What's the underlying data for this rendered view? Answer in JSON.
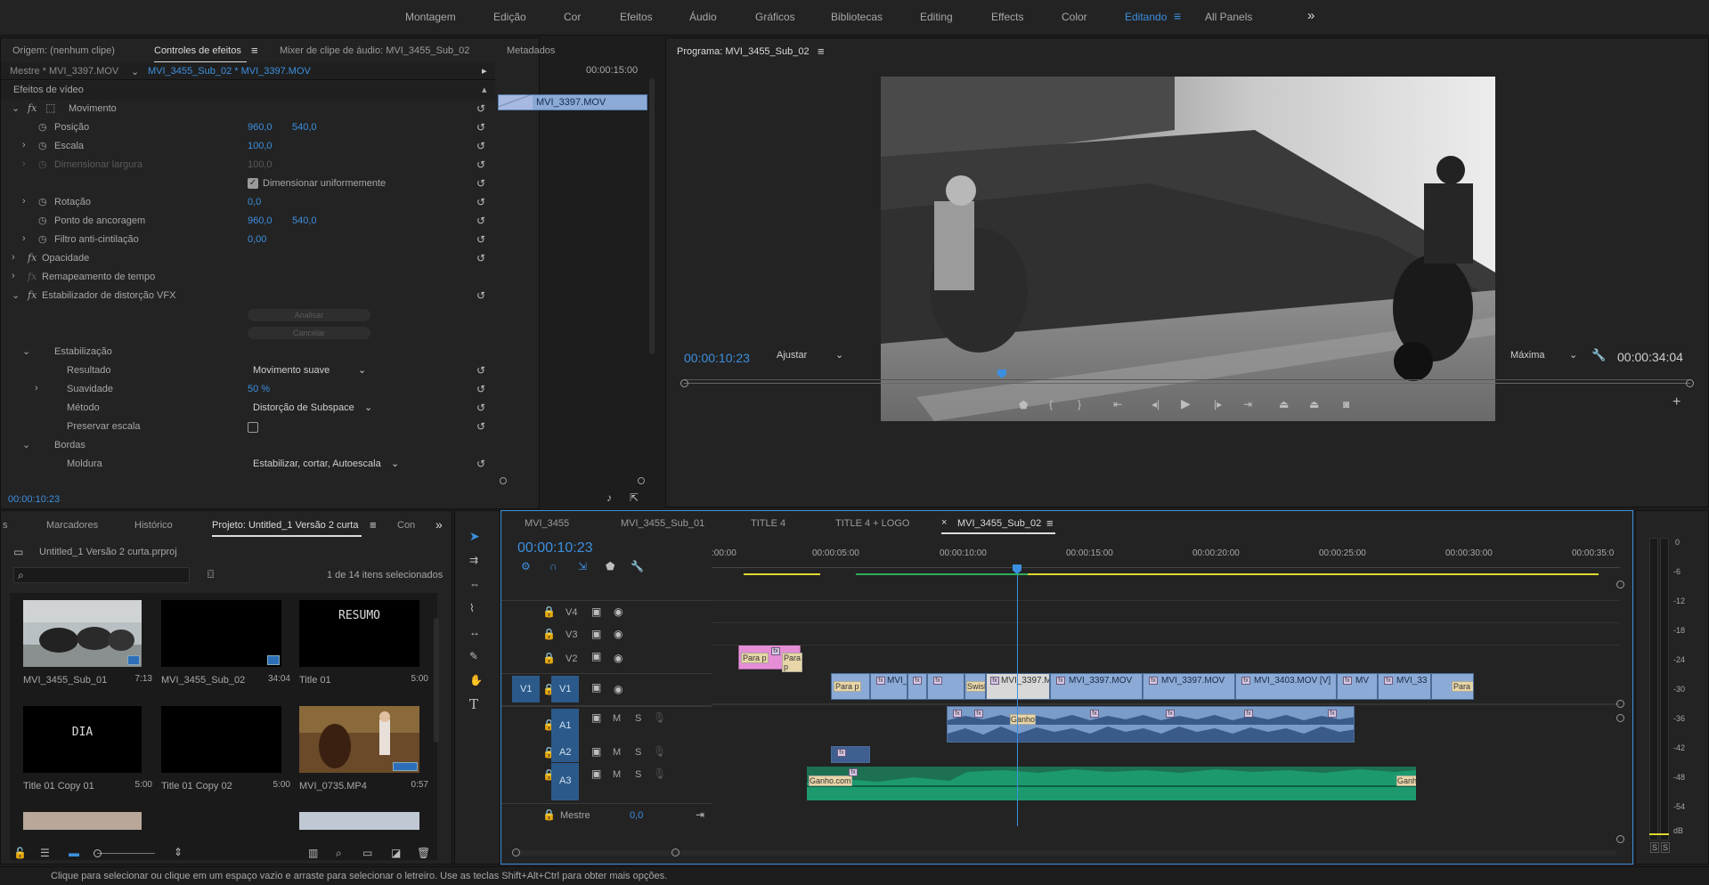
{
  "workspaces": [
    "Montagem",
    "Edição",
    "Cor",
    "Efeitos",
    "Áudio",
    "Gráficos",
    "Bibliotecas",
    "Editing",
    "Effects",
    "Color",
    "Editando",
    "All Panels"
  ],
  "workspace_active": "Editando",
  "effect_controls": {
    "tabs": [
      "Origem: (nenhum clipe)",
      "Controles de efeitos",
      "Mixer de clipe de áudio: MVI_3455_Sub_02",
      "Metadados"
    ],
    "active_tab": "Controles de efeitos",
    "master_label": "Mestre * MVI_3397.MOV",
    "sequence_label": "MVI_3455_Sub_02 * MVI_3397.MOV",
    "mini_timecode": "00:00:15:00",
    "mini_clip": "MVI_3397.MOV",
    "section_video": "Efeitos de vídeo",
    "motion": "Movimento",
    "position": "Posição",
    "position_x": "960,0",
    "position_y": "540,0",
    "scale": "Escala",
    "scale_val": "100,0",
    "scale_width": "Dimensionar largura",
    "scale_width_val": "100,0",
    "uniform_scale": "Dimensionar uniformemente",
    "rotation": "Rotação",
    "rotation_val": "0,0",
    "anchor": "Ponto de ancoragem",
    "anchor_x": "960,0",
    "anchor_y": "540,0",
    "flicker": "Filtro anti-cintilação",
    "flicker_val": "0,00",
    "opacity": "Opacidade",
    "time_remap": "Remapeamento de tempo",
    "vfx": "Estabilizador de distorção VFX",
    "analyze": "Analisar",
    "cancel": "Cancelar",
    "stabilization": "Estabilização",
    "result": "Resultado",
    "result_val": "Movimento suave",
    "smoothness": "Suavidade",
    "smoothness_val": "50 %",
    "method": "Método",
    "method_val": "Distorção de Subspace",
    "preserve_scale": "Preservar escala",
    "borders": "Bordas",
    "frame": "Moldura",
    "frame_val": "Estabilizar, cortar, Autoescala",
    "timecode": "00:00:10:23"
  },
  "program": {
    "title": "Programa: MVI_3455_Sub_02",
    "timecode": "00:00:10:23",
    "fit": "Ajustar",
    "quality": "Máxima",
    "duration": "00:00:34:04"
  },
  "project": {
    "tabs": [
      "s",
      "Marcadores",
      "Histórico",
      "Projeto: Untitled_1 Versão 2 curta",
      "Con"
    ],
    "active_tab": "Projeto: Untitled_1 Versão 2 curta",
    "file": "Untitled_1 Versão 2 curta.prproj",
    "search_placeholder": "",
    "selection": "1 de 14 itens selecionados",
    "items": [
      {
        "name": "MVI_3455_Sub_01",
        "dur": "7:13",
        "thumb": "moto"
      },
      {
        "name": "MVI_3455_Sub_02",
        "dur": "34:04",
        "thumb": "black"
      },
      {
        "name": "Title 01",
        "dur": "5:00",
        "thumb": "text",
        "text": "RESUMO"
      },
      {
        "name": "Title 01 Copy 01",
        "dur": "5:00",
        "thumb": "text",
        "text": "DIA"
      },
      {
        "name": "Title 01 Copy 02",
        "dur": "5:00",
        "thumb": "black"
      },
      {
        "name": "MVI_0735.MP4",
        "dur": "0:57",
        "thumb": "autumn"
      }
    ]
  },
  "timeline": {
    "tabs": [
      "MVI_3455",
      "MVI_3455_Sub_01",
      "TITLE 4",
      "TITLE 4 + LOGO",
      "MVI_3455_Sub_02"
    ],
    "active_tab": "MVI_3455_Sub_02",
    "timecode": "00:00:10:23",
    "ruler": [
      ":00:00",
      "00:00:05:00",
      "00:00:10:00",
      "00:00:15:00",
      "00:00:20:00",
      "00:00:25:00",
      "00:00:30:00",
      "00:00:35:0"
    ],
    "tracks_video": [
      "V4",
      "V3",
      "V2",
      "V1"
    ],
    "tracks_audio": [
      "A1",
      "A2",
      "A3"
    ],
    "source_v": "V1",
    "source_a": "A1",
    "master": "Mestre",
    "master_val": "0,0",
    "clips_v1": [
      "Para p",
      "MVI_",
      "",
      "",
      "Swish",
      "MVI_3397.MOV",
      "MVI_3397.MOV",
      "MVI_3397.MOV",
      "MVI_3403.MOV [V]",
      "MV",
      "MVI_33",
      "Para p"
    ],
    "clips_v2": [
      "Para p",
      "Para p"
    ],
    "clips_a1": [
      "Ganho"
    ],
    "clips_a3": [
      "Ganho.com",
      "Ganho"
    ]
  },
  "meter": {
    "scale": [
      "0",
      "-6",
      "-12",
      "-18",
      "-24",
      "-30",
      "-36",
      "-42",
      "-48",
      "-54",
      "dB"
    ],
    "solo": [
      "S",
      "S"
    ]
  },
  "status_bar": "Clique para selecionar ou clique em um espaço vazio e arraste para selecionar o letreiro. Use as teclas Shift+Alt+Ctrl para obter mais opções.",
  "colors": {
    "accent": "#3c8fde",
    "clip_blue": "#8baad6",
    "audio_green": "#1c9a6d",
    "pink": "#e58ed6",
    "yellow": "#e0d82e"
  }
}
